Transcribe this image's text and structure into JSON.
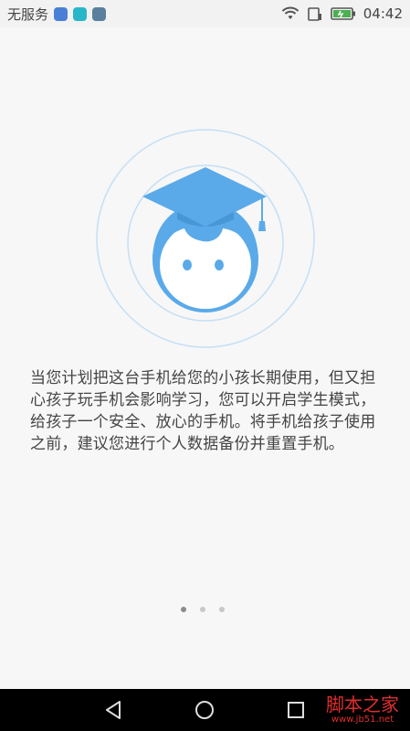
{
  "status_bar": {
    "carrier": "无服务",
    "time": "04:42",
    "app_icons": [
      "shield-app-icon",
      "pen-app-icon",
      "gallery-app-icon"
    ],
    "battery_level": 0.9
  },
  "main": {
    "description": "当您计划把这台手机给您的小孩长期使用，但又担心孩子玩手机会影响学习，您可以开启学生模式，给孩子一个安全、放心的手机。将手机给孩子使用之前，建议您进行个人数据备份并重置手机。",
    "pages": {
      "count": 3,
      "current": 1
    }
  },
  "nav_bar": {
    "buttons": [
      "back-icon",
      "home-icon",
      "recents-icon"
    ]
  },
  "watermark": {
    "main": "脚本之家",
    "sub": "www.jb51.net"
  },
  "colors": {
    "accent": "#5aaaea",
    "background": "#f7f7f7",
    "watermark": "#e22e2e"
  }
}
